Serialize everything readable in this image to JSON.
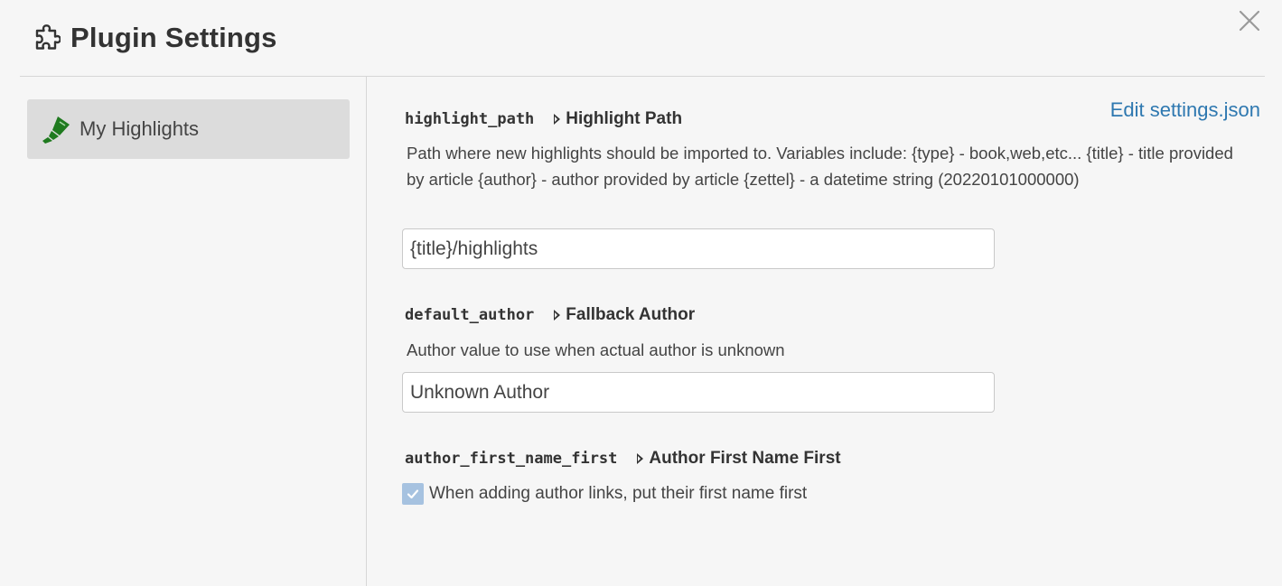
{
  "header": {
    "title": "Plugin Settings",
    "icon": "puzzle-icon",
    "close_icon": "close-icon"
  },
  "sidebar": {
    "items": [
      {
        "label": "My Highlights",
        "icon": "highlighter-icon",
        "selected": true
      }
    ]
  },
  "main": {
    "edit_link": "Edit settings.json",
    "settings": [
      {
        "key": "highlight_path",
        "name": "Highlight Path",
        "description": "Path where new highlights should be imported to. Variables include: {type} - book,web,etc... {title} - title provided by article {author} - author provided by article {zettel} - a datetime string (20220101000000)",
        "value": "{title}/highlights"
      },
      {
        "key": "default_author",
        "name": "Fallback Author",
        "description": "Author value to use when actual author is unknown",
        "value": "Unknown Author"
      },
      {
        "key": "author_first_name_first",
        "name": "Author First Name First",
        "checkbox_label": "When adding author links, put their first name first",
        "checked": true
      }
    ]
  },
  "colors": {
    "background": "#f6f6f6",
    "link": "#2e78b0",
    "sidebar_selected": "#dcdcdc",
    "highlighter_green": "#1f7a1f",
    "checkbox": "#a6c2e0"
  }
}
